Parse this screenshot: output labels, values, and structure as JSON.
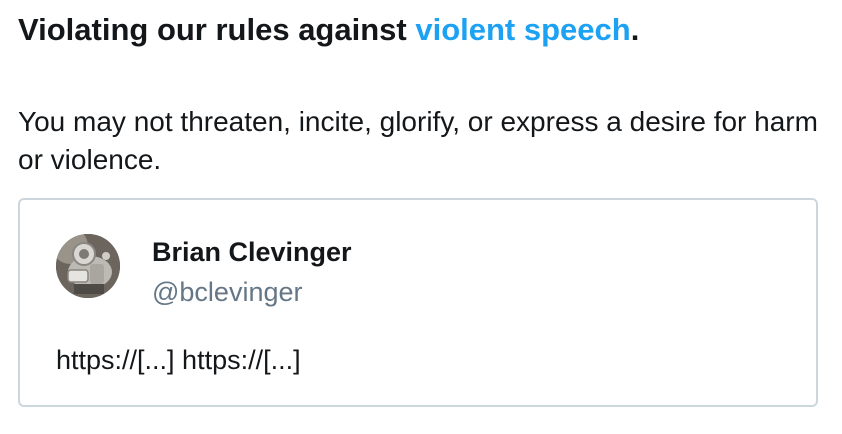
{
  "heading": {
    "prefix": "Violating our rules against ",
    "link_text": "violent speech",
    "suffix": "."
  },
  "description": "You may not threaten, incite, glorify, or express a desire for harm or violence.",
  "tweet": {
    "display_name": "Brian Clevinger",
    "handle": "@bclevinger",
    "text": "https://[...] https://[...]",
    "avatar_icon": "robot-avatar-icon"
  },
  "colors": {
    "link": "#1da1f2",
    "text": "#14171a",
    "handle": "#657786",
    "card_border": "#ccd6dd"
  }
}
